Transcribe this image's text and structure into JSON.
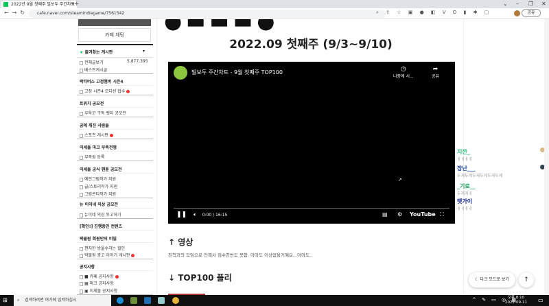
{
  "browser": {
    "tab_title": "2022년 9월 첫째주 빌보두 주간차트",
    "url": "cafe.naver.com/steamindiegame/7561542",
    "profile_button": "공유"
  },
  "sidebar": {
    "chat_button": "카페 채팅",
    "favorites_header": "즐겨찾는 게시판",
    "total_label": "전체글보기",
    "total_count": "5,877,395",
    "items": [
      {
        "type": "item",
        "label": "베스트게시글"
      },
      {
        "type": "header",
        "label": "락타버스 고정멤버 시즌4"
      },
      {
        "type": "item",
        "label": "고정 시즌4 오디션 접수",
        "new": true
      },
      {
        "type": "header",
        "label": "트위치 공모전"
      },
      {
        "type": "item",
        "label": "우학군 구독 뱃지 공모전"
      },
      {
        "type": "header",
        "label": "공예 취진 사람들"
      },
      {
        "type": "item",
        "label": "스포츠 게시판",
        "new": true
      },
      {
        "type": "header",
        "label": "이세돌 마크 부족전쟁"
      },
      {
        "type": "item",
        "label": "부족원 등록"
      },
      {
        "type": "header",
        "label": "이세돌 공식 팬툰 공모전"
      },
      {
        "type": "item",
        "label": "예인그림작가 지원"
      },
      {
        "type": "item",
        "label": "글/스토리작가 지원"
      },
      {
        "type": "item",
        "label": "그림콘티작가 지원"
      },
      {
        "type": "header",
        "label": "뉴 이이네 의상 공모전"
      },
      {
        "type": "item",
        "label": "뉴이네 의상 투고하기"
      },
      {
        "type": "header",
        "label": "[확인!] 진행중인 컨텐츠"
      },
      {
        "type": "header",
        "label": "락물원 회원만의 비밀"
      },
      {
        "type": "item",
        "label": "편치한 방울수치는 힐인"
      },
      {
        "type": "item",
        "label": "락물원 광고 이야기 게시판",
        "new": true
      },
      {
        "type": "header",
        "label": "공지사항"
      },
      {
        "type": "item",
        "label": "■ 카페 공지사항",
        "new": true
      },
      {
        "type": "item",
        "label": "▦ 마크 공지사항"
      },
      {
        "type": "item",
        "label": "▣ 이세돌 공지사항"
      }
    ]
  },
  "main": {
    "title": "2022.09 첫째주 (9/3~9/10)",
    "video": {
      "title": "빌보두 주간차트 - 9월 첫째주 TOP100",
      "watch_later": "나중에 시...",
      "share": "공유",
      "time": "0:00 / 16:15",
      "brand": "YouTube"
    },
    "section1_heading": "↑ 영상",
    "section1_text": "친척과의 모임으로 인해서 검수한번도 못함. 아마도 이상없을거예요...아마도..",
    "section2_heading": "↓ TOP100 플리"
  },
  "chat": [
    {
      "name": "지깐_",
      "msg": "ㅔㅔㅔㅔ",
      "color": "#2db87d"
    },
    {
      "name": "장난___",
      "msg": "두게두게두게두게두게두게",
      "color": "#1a3fa6"
    },
    {
      "name": "_기로__",
      "msg": "두게게ㅔ",
      "color": "#1aa05a"
    },
    {
      "name": "텟가이",
      "msg": "ㅔㅔㅔㅔ",
      "color": "#0a1f8f"
    }
  ],
  "buttons": {
    "dark_mode": "다크 모드로 보기",
    "to_top": "↑"
  },
  "taskbar": {
    "search_placeholder": "검색하려면 여기에 입력하십시",
    "time": "오후 8:10",
    "date": "2022-09-11"
  }
}
